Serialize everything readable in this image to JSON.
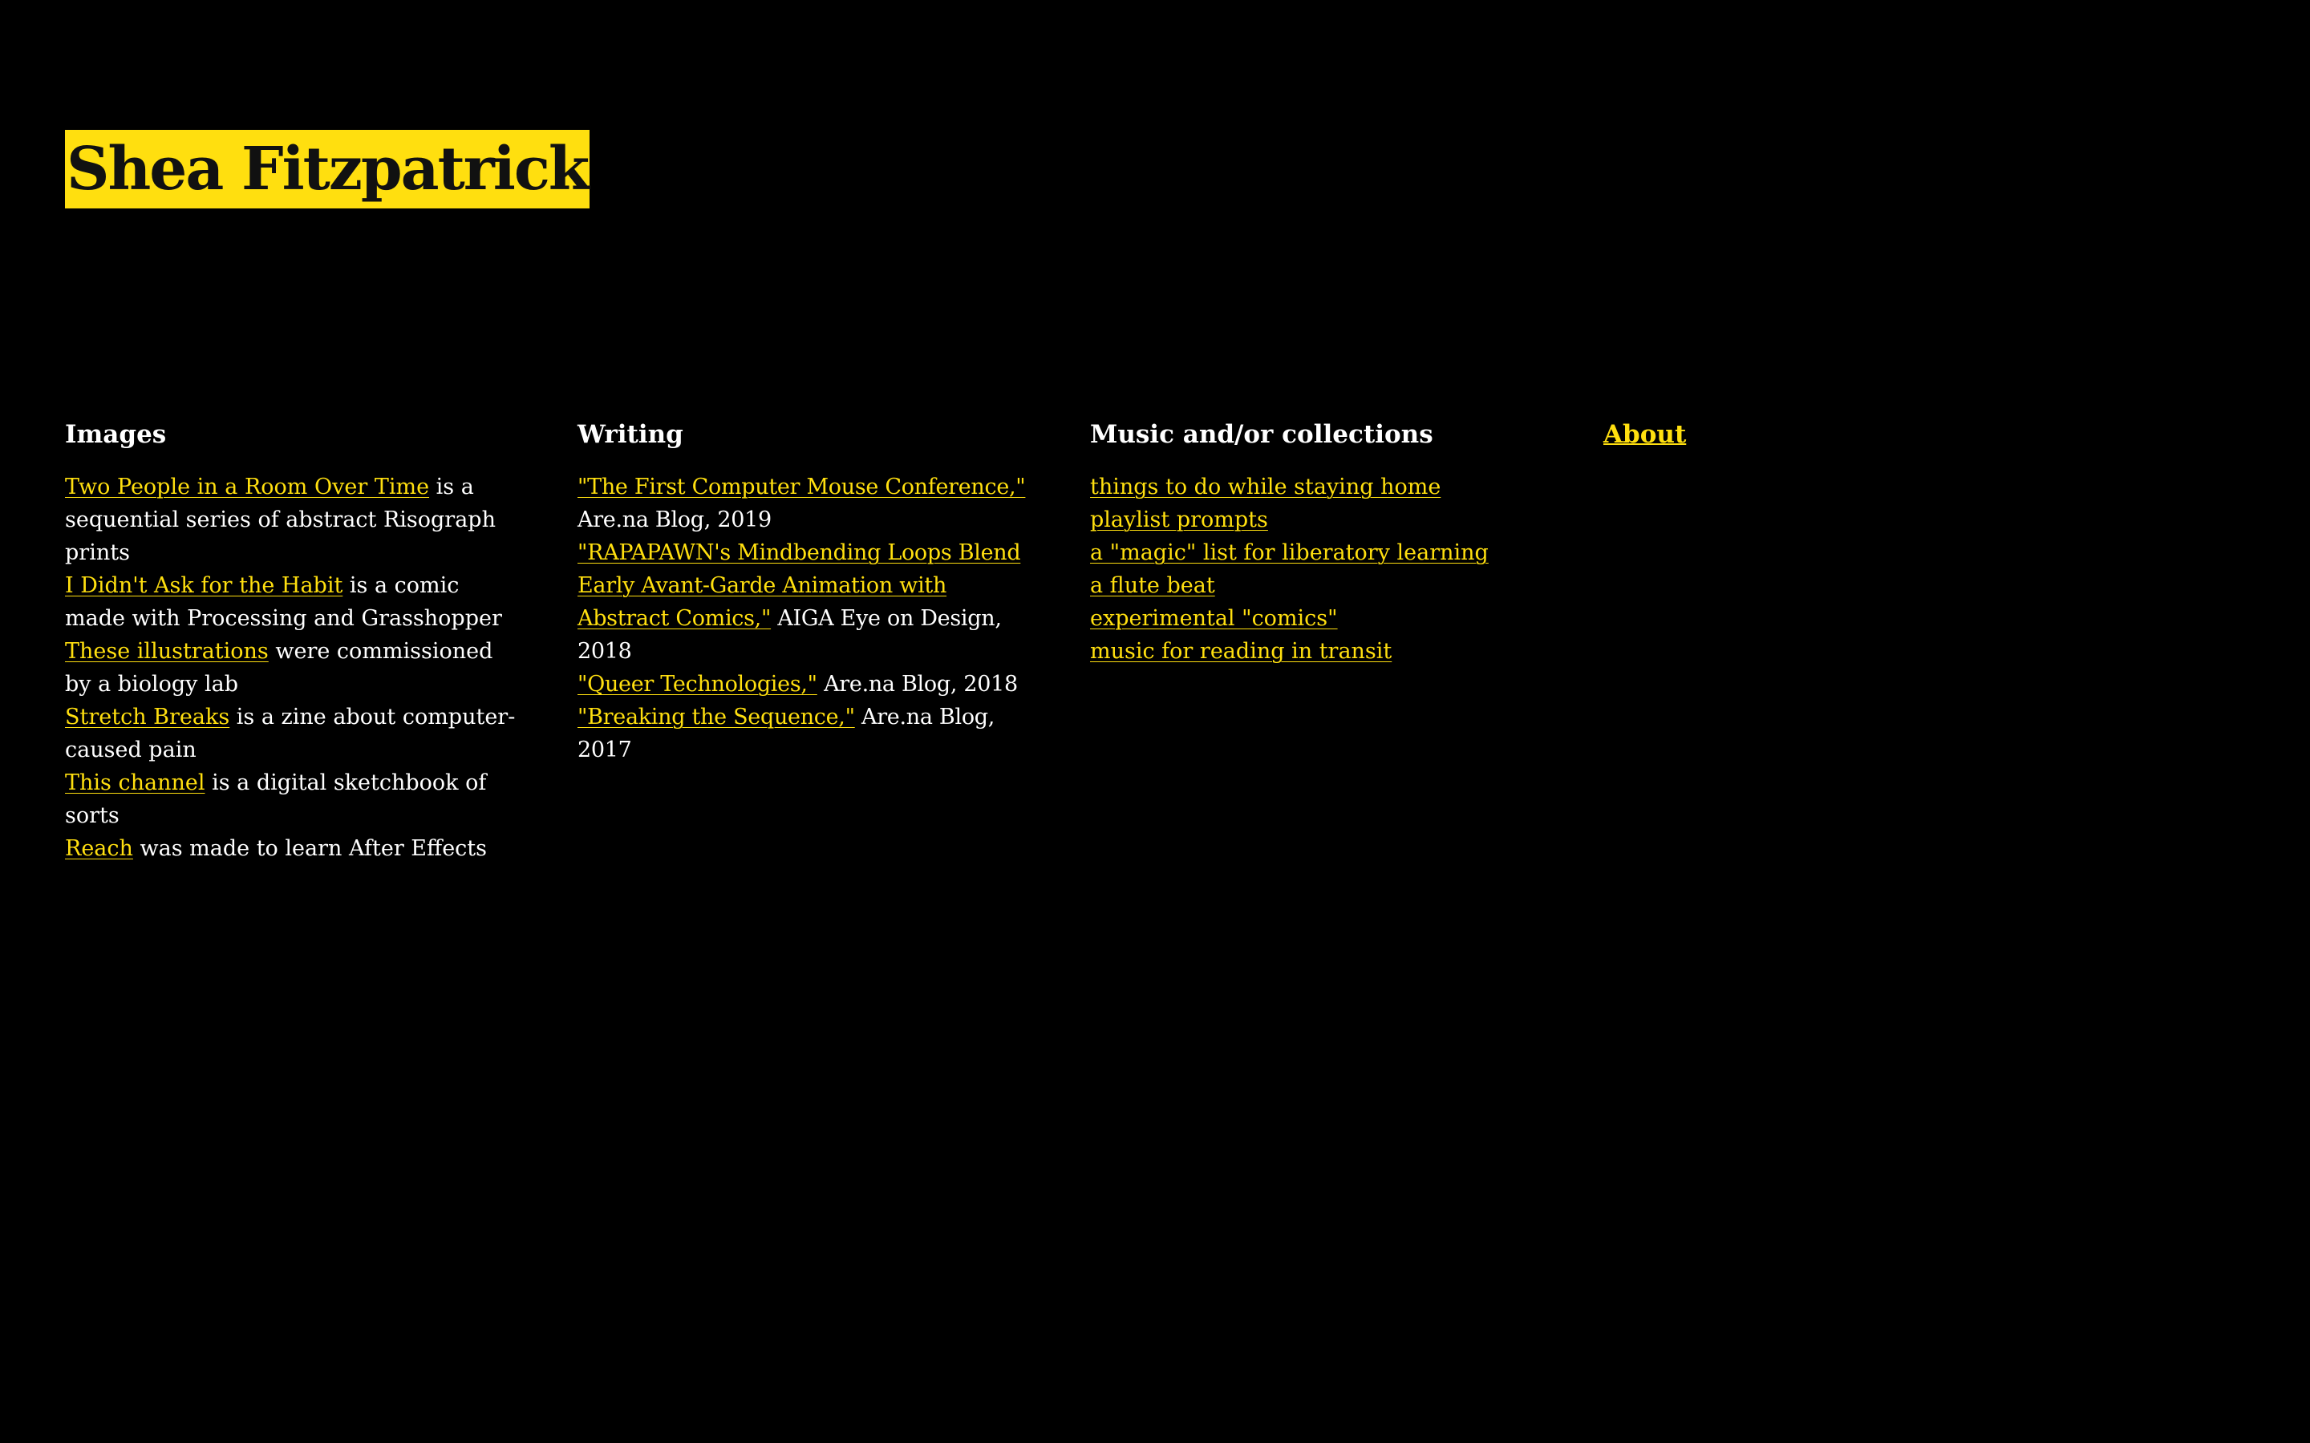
{
  "header": {
    "title": "Shea Fitzpatrick"
  },
  "colors": {
    "background": "#000000",
    "accent": "#ffdf0f",
    "text": "#ffffff"
  },
  "images": {
    "heading": "Images",
    "items": [
      {
        "link": "Two People in a Room Over Time",
        "text": " is a sequential series of abstract Risograph prints"
      },
      {
        "link": "I Didn't Ask for the Habit",
        "text": " is a comic made with Processing and Grasshopper"
      },
      {
        "link": "These illustrations",
        "text": " were commissioned by a biology lab"
      },
      {
        "link": "Stretch Breaks",
        "text": " is a zine about computer-caused pain"
      },
      {
        "link": "This channel",
        "text": " is a digital sketchbook of sorts"
      },
      {
        "link": "Reach",
        "text": " was made to learn After Effects"
      }
    ]
  },
  "writing": {
    "heading": "Writing",
    "items": [
      {
        "link": "\"The First Computer Mouse Conference,\"",
        "text": " Are.na Blog, 2019"
      },
      {
        "link": "\"RAPAPAWN's Mindbending Loops Blend Early Avant-Garde Animation with Abstract Comics,\"",
        "text": " AIGA Eye on Design, 2018"
      },
      {
        "link": "\"Queer Technologies,\"",
        "text": " Are.na Blog, 2018"
      },
      {
        "link": "\"Breaking the Sequence,\"",
        "text": " Are.na Blog, 2017"
      }
    ]
  },
  "music": {
    "heading": "Music and/or collections",
    "items": [
      {
        "link": "things to do while staying home"
      },
      {
        "link": "playlist prompts"
      },
      {
        "link": "a \"magic\" list for liberatory learning"
      },
      {
        "link": "a flute beat"
      },
      {
        "link": "experimental \"comics\""
      },
      {
        "link": "music for reading in transit"
      }
    ]
  },
  "about": {
    "label": "About"
  }
}
